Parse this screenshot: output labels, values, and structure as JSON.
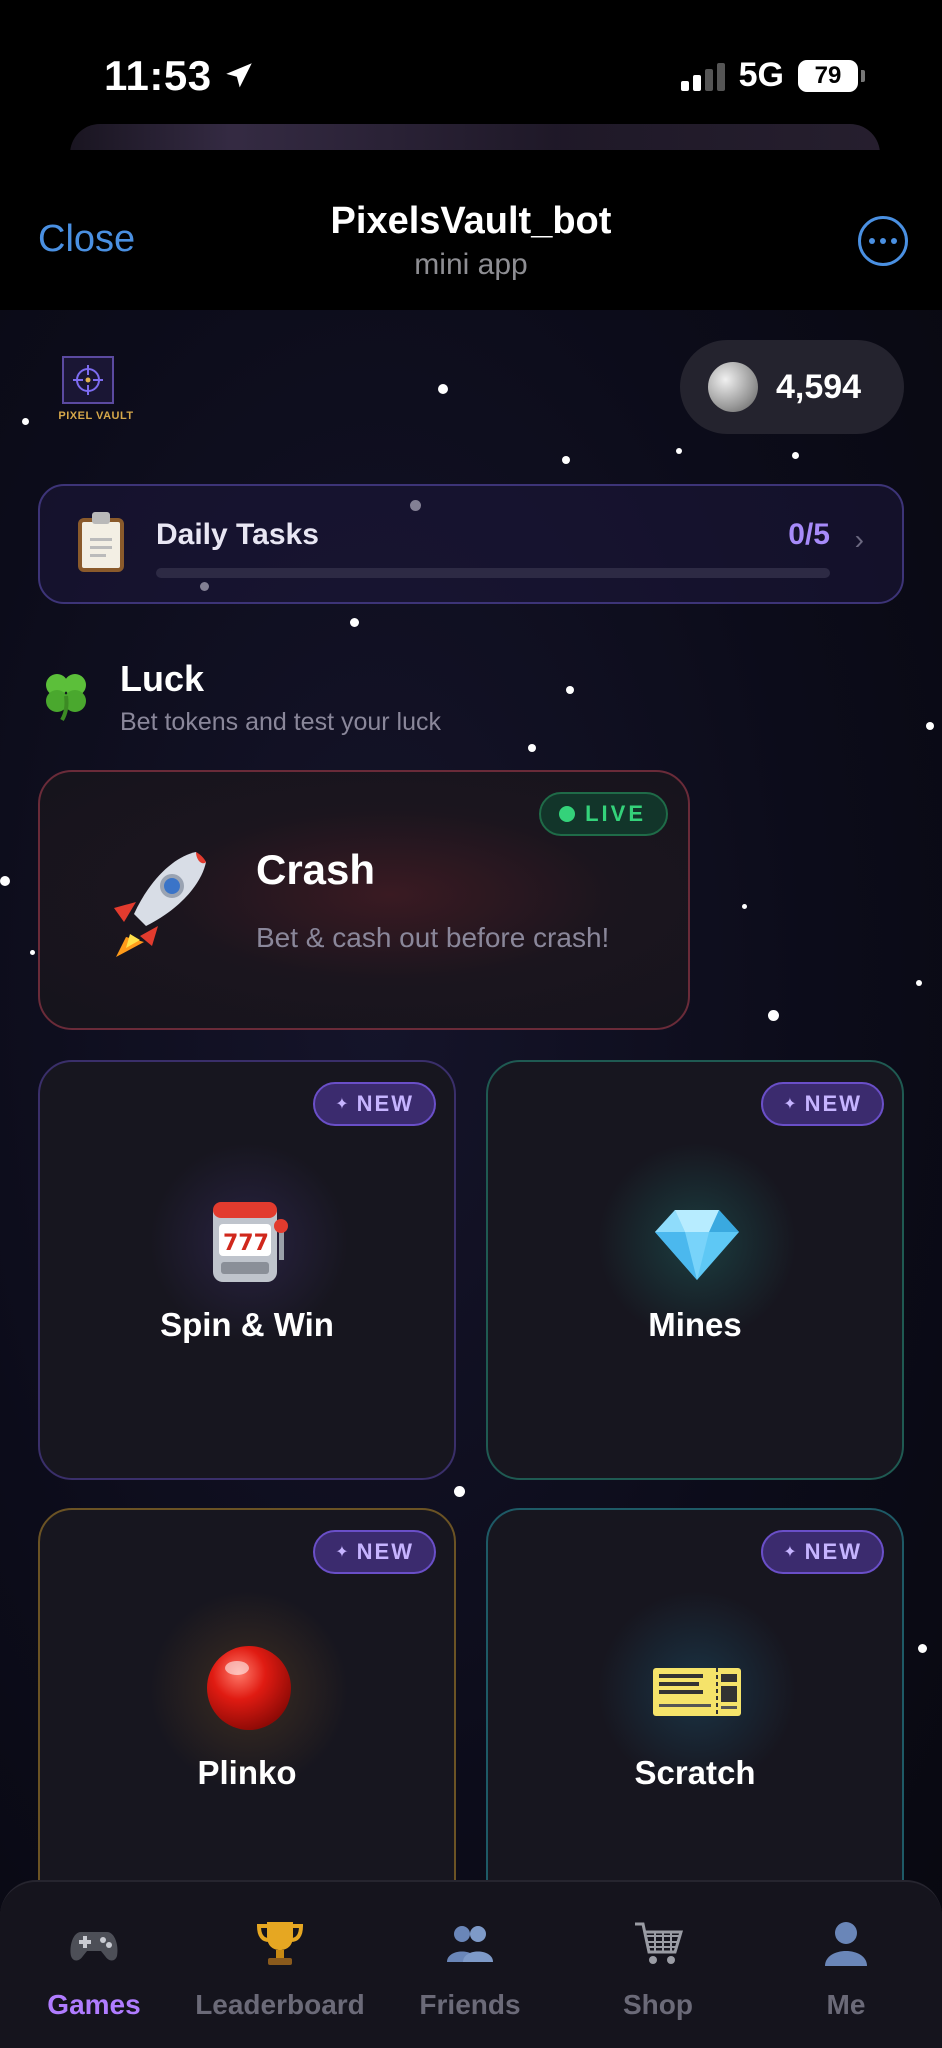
{
  "status_bar": {
    "time": "11:53",
    "network": "5G",
    "battery": "79"
  },
  "telegram": {
    "close_label": "Close",
    "title": "PixelsVault_bot",
    "subtitle": "mini app"
  },
  "brand": {
    "logo_text": "PIXEL VAULT"
  },
  "balance": {
    "value": "4,594",
    "icon": "silver-coin-icon"
  },
  "daily_tasks": {
    "label": "Daily Tasks",
    "count": "0/5",
    "progress": 0,
    "icon": "clipboard-icon"
  },
  "section": {
    "title": "Luck",
    "subtitle": "Bet tokens and test your luck",
    "icon": "four-leaf-clover-icon"
  },
  "featured": {
    "title": "Crash",
    "subtitle": "Bet & cash out before crash!",
    "badge": "LIVE",
    "icon": "rocket-icon"
  },
  "games": [
    {
      "title": "Spin & Win",
      "badge": "NEW",
      "icon": "slot-machine-icon"
    },
    {
      "title": "Mines",
      "badge": "NEW",
      "icon": "gem-icon"
    },
    {
      "title": "Plinko",
      "badge": "NEW",
      "icon": "red-ball-icon"
    },
    {
      "title": "Scratch",
      "badge": "NEW",
      "icon": "ticket-icon"
    }
  ],
  "tabs": [
    {
      "label": "Games",
      "icon": "gamepad-icon",
      "active": true
    },
    {
      "label": "Leaderboard",
      "icon": "trophy-icon",
      "active": false
    },
    {
      "label": "Friends",
      "icon": "people-icon",
      "active": false
    },
    {
      "label": "Shop",
      "icon": "cart-icon",
      "active": false
    },
    {
      "label": "Me",
      "icon": "person-icon",
      "active": false
    }
  ],
  "colors": {
    "accent": "#a78bfa",
    "tg_blue": "#4a90e2",
    "live_green": "#34d27a",
    "active_tab": "#b07cff"
  }
}
